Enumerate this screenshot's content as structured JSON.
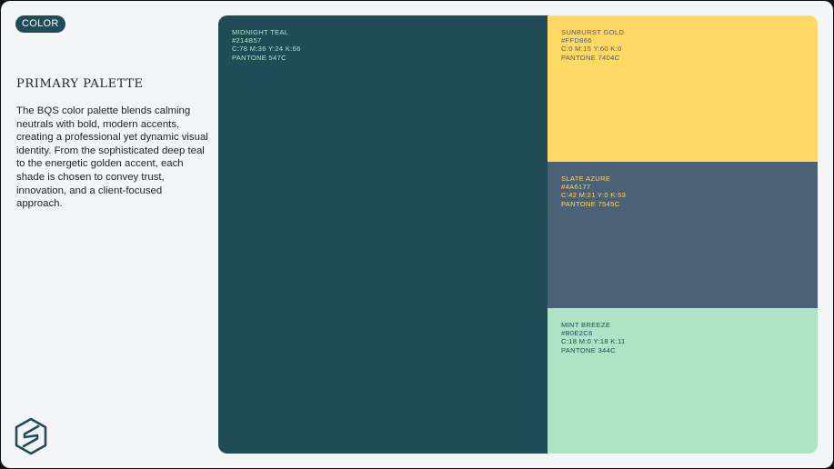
{
  "tag": {
    "label": "COLOR"
  },
  "section": {
    "title": "PRIMARY PALETTE",
    "description": "The BQS color palette blends calming neutrals with bold, modern accents, creating a professional yet dynamic visual identity. From the sophisticated deep teal to the energetic golden accent, each shade is chosen to convey trust, innovation, and a client-focused approach."
  },
  "logo": {
    "icon": "bqs-s-logo-icon",
    "color": "#214B57"
  },
  "palette": {
    "swatches": [
      {
        "name": "MIDNIGHT TEAL",
        "hex": "#214B57",
        "cmyk": "C:78 M:36 Y:24 K:66",
        "pantone": "PANTONE 547C",
        "color": "#214B57",
        "text_color": "#B0E2C6"
      },
      {
        "name": "SUNBURST GOLD",
        "hex": "#FFD866",
        "cmyk": "C:0 M:15 Y:60 K:0",
        "pantone": "PANTONE 7404C",
        "color": "#FFD866",
        "text_color": "#4A6177"
      },
      {
        "name": "SLATE AZURE",
        "hex": "#4A6177",
        "cmyk": "C:42 M:21 Y:0 K:53",
        "pantone": "PANTONE 7545C",
        "color": "#4A6177",
        "text_color": "#FFD866"
      },
      {
        "name": "MINT BREEZE",
        "hex": "#B0E2C6",
        "cmyk": "C:18 M:0 Y:18 K:11",
        "pantone": "PANTONE 344C",
        "color": "#B0E2C6",
        "text_color": "#214B57"
      }
    ]
  }
}
